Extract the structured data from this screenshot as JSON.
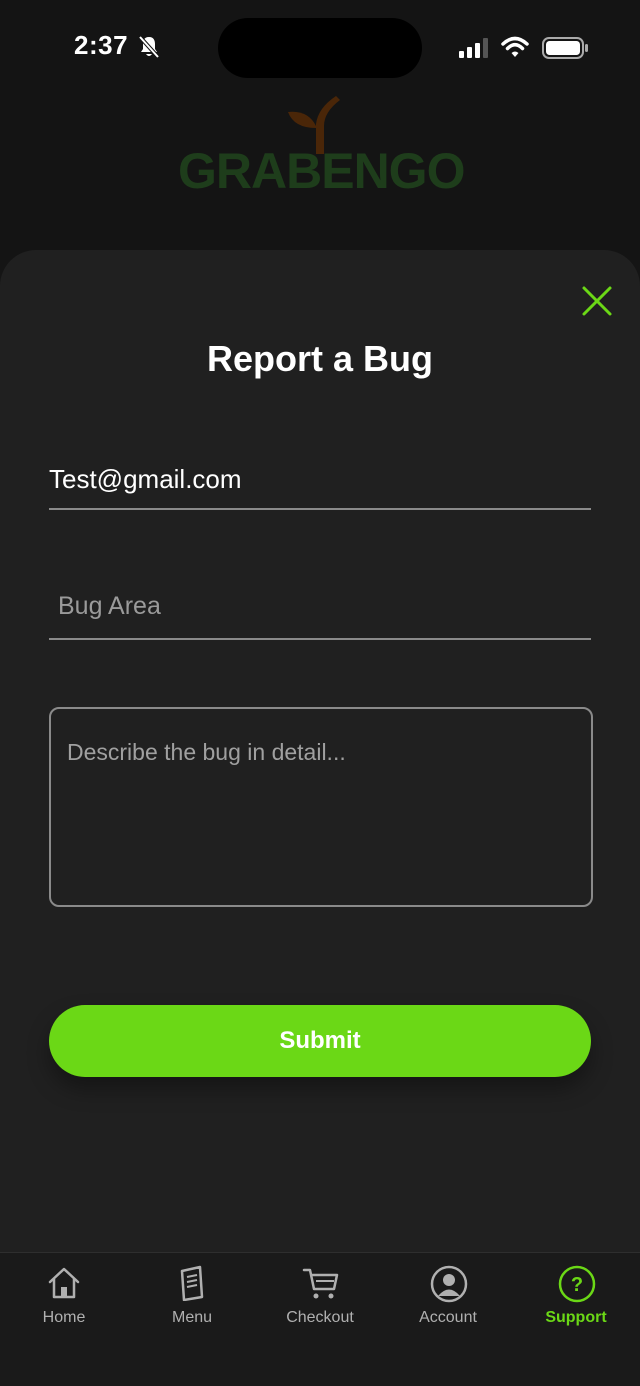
{
  "status_bar": {
    "time": "2:37"
  },
  "brand": {
    "name": "GRABENGO"
  },
  "form": {
    "title": "Report a Bug",
    "email_value": "Test@gmail.com",
    "bug_area_placeholder": "Bug Area",
    "description_placeholder": "Describe the bug in detail...",
    "submit_label": "Submit"
  },
  "tabs": [
    {
      "label": "Home",
      "icon": "home-icon",
      "active": false
    },
    {
      "label": "Menu",
      "icon": "menu-book-icon",
      "active": false
    },
    {
      "label": "Checkout",
      "icon": "cart-icon",
      "active": false
    },
    {
      "label": "Account",
      "icon": "account-icon",
      "active": false
    },
    {
      "label": "Support",
      "icon": "help-circle-icon",
      "active": true
    }
  ],
  "colors": {
    "accent": "#6bd816",
    "sheet_background": "#202020",
    "logo_green": "#1e3d1b",
    "logo_sprout": "#4a2608"
  }
}
